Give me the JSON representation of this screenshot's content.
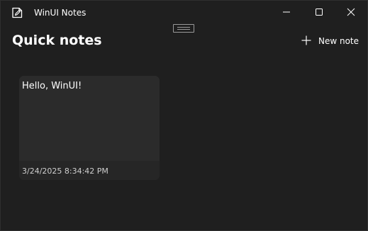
{
  "window": {
    "title": "WinUI Notes"
  },
  "titlebar": {
    "app_icon": "notes-app-icon",
    "minimize_icon": "minimize-icon",
    "maximize_icon": "maximize-icon",
    "close_icon": "close-icon"
  },
  "page": {
    "title": "Quick notes"
  },
  "toolbar": {
    "new_note_label": "New note",
    "new_note_icon": "plus-icon"
  },
  "notes": [
    {
      "text": "Hello, WinUI!",
      "date": "3/24/2025 8:34:42 PM"
    }
  ],
  "colors": {
    "background": "#1f1f1f",
    "card": "#2b2b2b",
    "card_footer": "#262626",
    "text": "#ffffff",
    "secondary_text": "#cfcfcf"
  }
}
